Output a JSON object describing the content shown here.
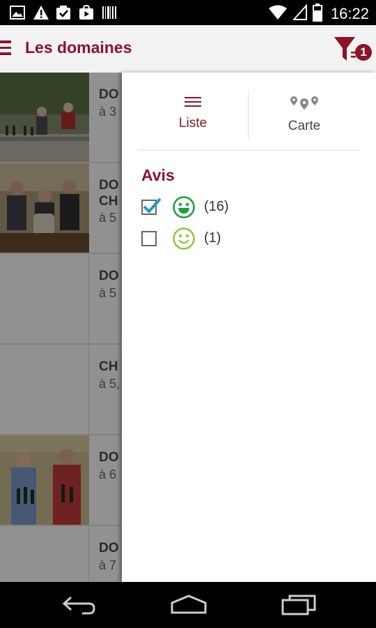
{
  "status_bar": {
    "time": "16:22",
    "icons": [
      "image-icon",
      "warning-icon",
      "checklist-icon",
      "play-store-icon",
      "barcode-icon",
      "wifi-icon",
      "signal-icon",
      "battery-icon"
    ]
  },
  "app_bar": {
    "title": "Les domaines",
    "menu_icon": "hamburger-menu-icon",
    "filter_icon": "filter-icon",
    "filter_badge": "1"
  },
  "list": {
    "items": [
      {
        "name": "DO",
        "distance": "à 3",
        "photo": true
      },
      {
        "name": "DO\nCH",
        "distance": "à 5",
        "photo": true
      },
      {
        "name": "DO",
        "distance": "à 5",
        "photo": false
      },
      {
        "name": "CH",
        "distance": "à 5,",
        "photo": false
      },
      {
        "name": "DO",
        "distance": "à 6",
        "photo": true
      },
      {
        "name": "DO",
        "distance": "à 7",
        "photo": false
      }
    ]
  },
  "drawer": {
    "tabs": [
      {
        "label": "Liste",
        "icon": "list-icon",
        "selected": true
      },
      {
        "label": "Carte",
        "icon": "map-pins-icon",
        "selected": false
      }
    ],
    "section_title": "Avis",
    "options": [
      {
        "count": "(16)",
        "checked": true,
        "icon": "big-smile-icon",
        "color": "#1e9e3a"
      },
      {
        "count": "(1)",
        "checked": false,
        "icon": "smile-icon",
        "color": "#8cc63f"
      }
    ]
  },
  "colors": {
    "brand": "#8c1427",
    "check": "#2196c8"
  }
}
